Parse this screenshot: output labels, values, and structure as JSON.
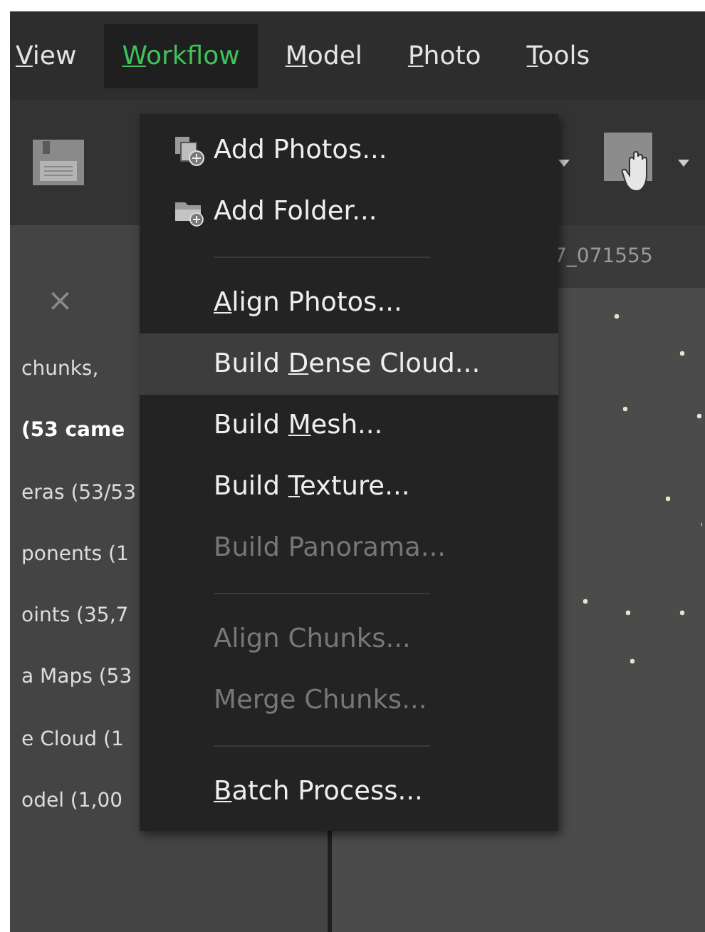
{
  "menu_bar": [
    {
      "mnemonic": "V",
      "label_rest": "iew",
      "selected": false
    },
    {
      "mnemonic": "W",
      "label_rest": "orkflow",
      "selected": true
    },
    {
      "mnemonic": "M",
      "label_rest": "odel",
      "selected": false
    },
    {
      "mnemonic": "P",
      "label_rest": "hoto",
      "selected": false
    },
    {
      "mnemonic": "T",
      "label_rest": "ools",
      "selected": false
    }
  ],
  "viewport": {
    "tab_label": "7_071555"
  },
  "workspace_panel": {
    "close_label": "×",
    "items": [
      {
        "label": "chunks,",
        "active": false
      },
      {
        "label": "(53 came",
        "active": true
      },
      {
        "label": "eras (53/53",
        "active": false
      },
      {
        "label": "ponents (1",
        "active": false
      },
      {
        "label": "oints (35,7",
        "active": false
      },
      {
        "label": "a Maps (53",
        "active": false
      },
      {
        "label": "e Cloud (1",
        "active": false
      },
      {
        "label": "odel (1,00",
        "active": false
      }
    ]
  },
  "workflow_menu": {
    "items": [
      {
        "kind": "item",
        "label_start": "Add Photos...",
        "icon": true,
        "disabled": false,
        "selected": false
      },
      {
        "kind": "item",
        "label_start": "Add Folder...",
        "icon": true,
        "disabled": false,
        "selected": false
      },
      {
        "kind": "separator"
      },
      {
        "kind": "item",
        "mnemonic": "A",
        "label_rest": "lign Photos...",
        "disabled": false,
        "selected": false
      },
      {
        "kind": "item",
        "label_start": "Build ",
        "mnemonic": "D",
        "label_rest": "ense Cloud...",
        "disabled": false,
        "selected": true
      },
      {
        "kind": "item",
        "label_start": "Build ",
        "mnemonic": "M",
        "label_rest": "esh...",
        "disabled": false,
        "selected": false
      },
      {
        "kind": "item",
        "label_start": "Build ",
        "mnemonic": "T",
        "label_rest": "exture...",
        "disabled": false,
        "selected": false
      },
      {
        "kind": "item",
        "label_start": "Build Panorama...",
        "disabled": true,
        "selected": false
      },
      {
        "kind": "separator"
      },
      {
        "kind": "item",
        "label_start": "Align Chunks...",
        "disabled": true,
        "selected": false
      },
      {
        "kind": "item",
        "label_start": "Merge Chunks...",
        "disabled": true,
        "selected": false
      },
      {
        "kind": "separator"
      },
      {
        "kind": "item",
        "mnemonic": "B",
        "label_rest": "atch Process...",
        "disabled": false,
        "selected": false
      }
    ]
  }
}
